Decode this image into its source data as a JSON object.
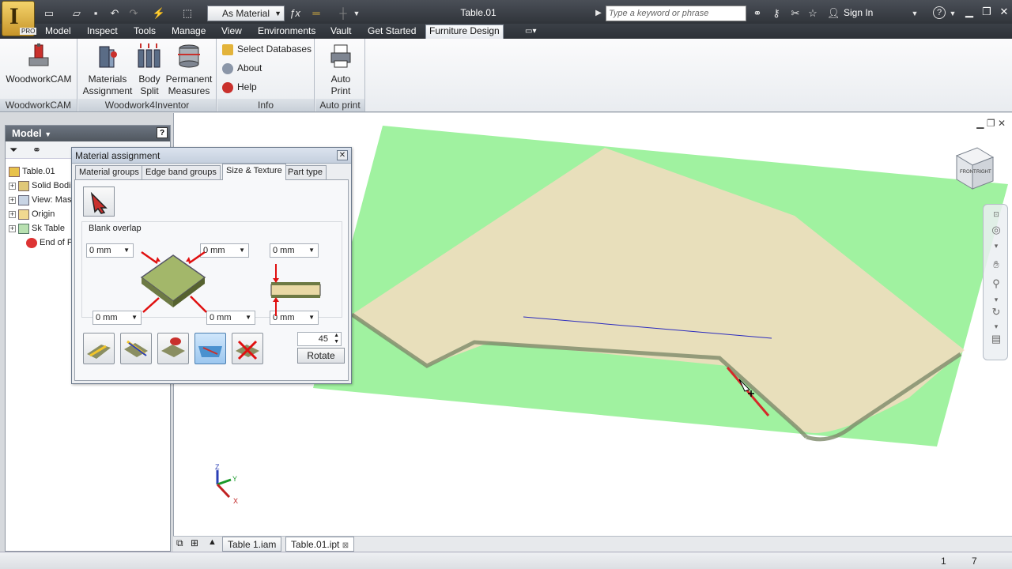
{
  "titlebar": {
    "app_pro_label": "PRO",
    "material_combo": "As Material",
    "doc_title": "Table.01",
    "search_placeholder": "Type a keyword or phrase",
    "sign_in": "Sign In"
  },
  "menu": {
    "tabs": [
      "Model",
      "Inspect",
      "Tools",
      "Manage",
      "View",
      "Environments",
      "Vault",
      "Get Started",
      "Furniture Design"
    ],
    "active": "Furniture Design"
  },
  "ribbon": {
    "panels": [
      {
        "title": "WoodworkCAM",
        "buttons": [
          {
            "label": "WoodworkCAM"
          }
        ]
      },
      {
        "title": "Woodwork4Inventor",
        "buttons": [
          {
            "label": "Materials Assignment"
          },
          {
            "label": "Body Split"
          },
          {
            "label": "Permanent Measures"
          }
        ]
      },
      {
        "title": "Info",
        "buttons": [
          {
            "label": "Select Databases"
          },
          {
            "label": "About"
          },
          {
            "label": "Help"
          }
        ]
      },
      {
        "title": "Auto print",
        "buttons": [
          {
            "label": "Auto Print"
          }
        ]
      }
    ]
  },
  "browser": {
    "title": "Model",
    "help": "?",
    "tree": [
      {
        "label": "Table.01",
        "expand": false
      },
      {
        "label": "Solid Bodies",
        "expand": true
      },
      {
        "label": "View: Master",
        "expand": true
      },
      {
        "label": "Origin",
        "expand": true
      },
      {
        "label": "Sk Table",
        "expand": true
      },
      {
        "label": "End of Part",
        "expand": false
      }
    ]
  },
  "dialog": {
    "title": "Material assignment",
    "tabs": [
      "Material groups",
      "Edge band groups",
      "Size & Texture",
      "Part type"
    ],
    "active_tab": "Size & Texture",
    "section_label": "Blank overlap",
    "overlaps": {
      "top_left": "0 mm",
      "top_right": "0 mm",
      "bottom_left": "0 mm",
      "bottom_right": "0 mm",
      "thickness_top": "0 mm",
      "thickness_bottom": "0 mm"
    },
    "rotate_angle": "45",
    "rotate_label": "Rotate",
    "selected_texture_index": 3
  },
  "viewport": {
    "axis_labels": {
      "x": "X",
      "y": "Y",
      "z": "Z"
    },
    "viewcube_labels": {
      "front": "FRONT",
      "right": "RIGHT"
    }
  },
  "doctabs": [
    {
      "label": "Table 1.iam",
      "active": false
    },
    {
      "label": "Table.01.ipt",
      "active": true
    }
  ],
  "status": {
    "left_num": "1",
    "right_num": "7"
  },
  "colors": {
    "accent": "#1e6fb5",
    "sheet_green": "#8ff08f",
    "wood": "#f5dcc0"
  }
}
